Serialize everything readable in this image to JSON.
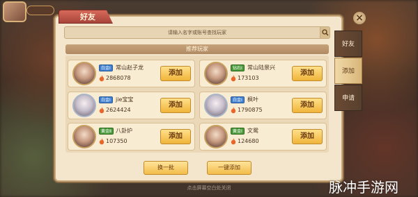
{
  "dialog": {
    "title": "好友",
    "search_placeholder": "请输入名字或账号查找玩家",
    "section_title": "推荐玩家"
  },
  "close_label": "×",
  "side_tabs": [
    {
      "label": "好友",
      "active": false
    },
    {
      "label": "添加",
      "active": true
    },
    {
      "label": "申请",
      "active": false
    }
  ],
  "players": [
    {
      "rank": "白金Ⅰ",
      "name": "常山赵子龙",
      "power": "2868078",
      "add_label": "添加"
    },
    {
      "rank": "钻石Ⅰ",
      "name": "常山陆景兴",
      "power": "173103",
      "add_label": "添加"
    },
    {
      "rank": "白金Ⅰ",
      "name": "jie宝宝",
      "power": "2624424",
      "add_label": "添加"
    },
    {
      "rank": "白金Ⅰ",
      "name": "枫叶",
      "power": "1790875",
      "add_label": "添加"
    },
    {
      "rank": "黄金Ⅱ",
      "name": "八卦炉",
      "power": "107350",
      "add_label": "添加"
    },
    {
      "rank": "黄金Ⅰ",
      "name": "文鸳",
      "power": "124680",
      "add_label": "添加"
    }
  ],
  "footer": {
    "refresh_label": "换一批",
    "add_all_label": "一键添加"
  },
  "bottom_hint": "点击屏幕空白处关闭",
  "watermark": "脉冲手游网",
  "colors": {
    "accent_red": "#c04a3e",
    "button_gold": "#f0b43a",
    "panel_bg": "#f3e6cc"
  }
}
